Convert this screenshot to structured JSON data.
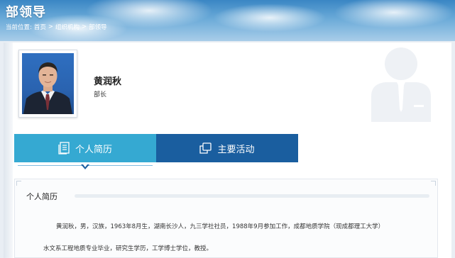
{
  "header": {
    "title": "部领导",
    "breadcrumb": {
      "prefix": "当前位置:",
      "items": [
        "首页",
        "组织机构",
        "部领导"
      ],
      "separator": ">"
    }
  },
  "leader": {
    "name": "黄润秋",
    "position": "部长"
  },
  "tabs": [
    {
      "label": "个人简历",
      "icon": "document-icon",
      "active": true
    },
    {
      "label": "主要活动",
      "icon": "copy-icon",
      "active": false
    }
  ],
  "section": {
    "title": "个人简历",
    "bio_lines": [
      "黄润秋，男，汉族，1963年8月生，湖南长沙人，九三学社社员，1988年9月参加工作，成都地质学院（现成都理工大学）",
      "水文系工程地质专业毕业，研究生学历，工学博士学位，教授。"
    ]
  },
  "colors": {
    "tab_active": "#35a9d2",
    "tab_inactive": "#1a5e9f",
    "banner": "#3a86c4"
  }
}
